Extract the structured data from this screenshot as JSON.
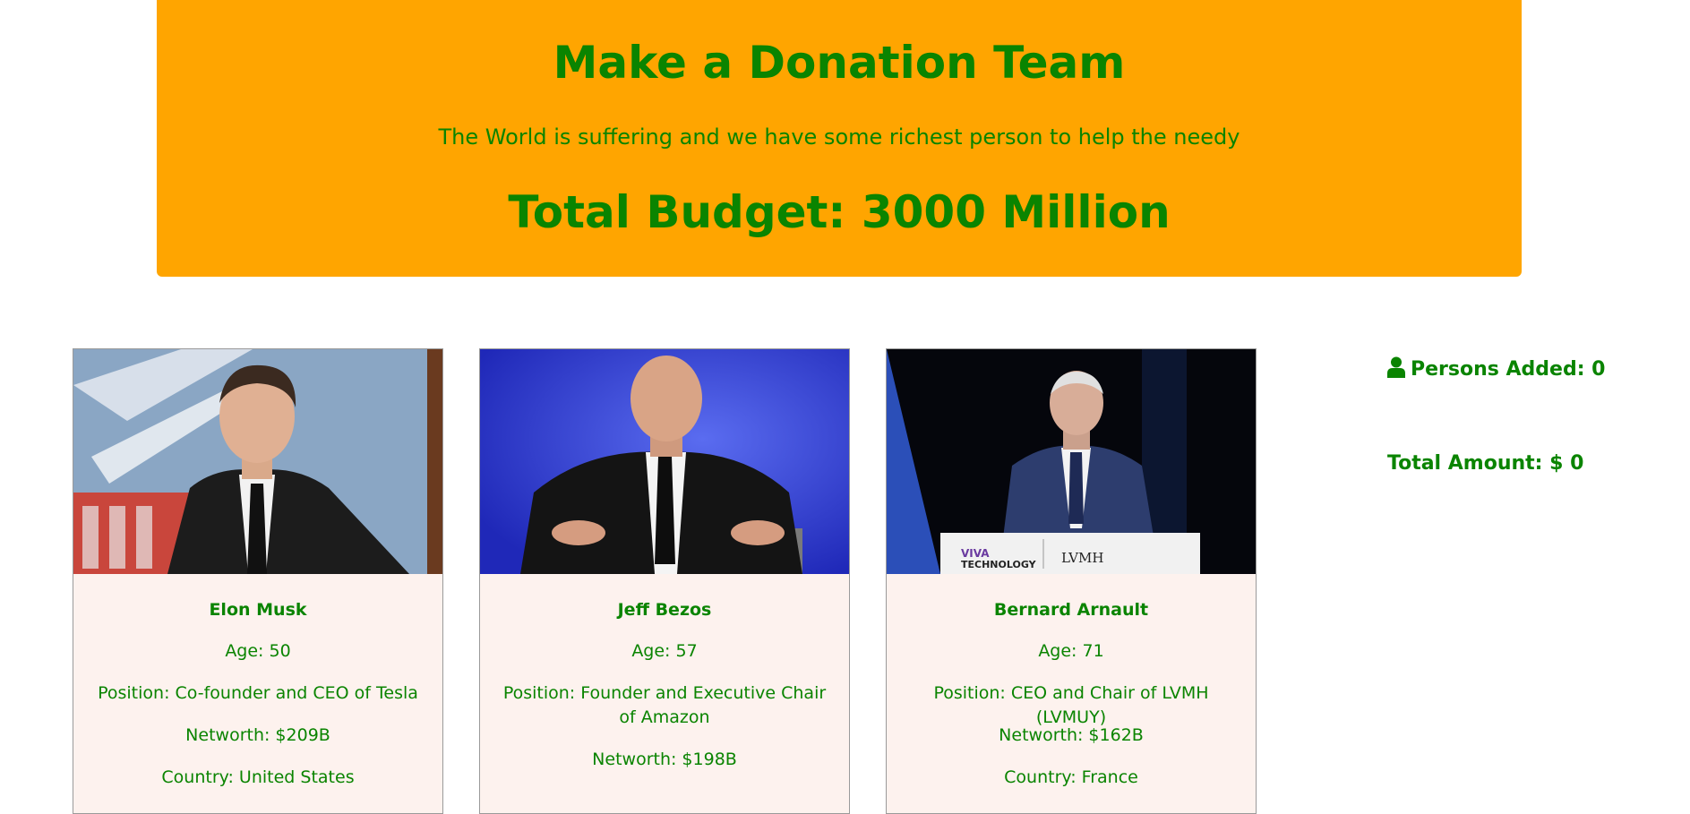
{
  "header": {
    "title": "Make a Donation Team",
    "subtitle": "The World is suffering and we have some richest person to help the needy",
    "budget": "Total Budget: 3000 Million"
  },
  "cards": [
    {
      "name": "Elon Musk",
      "age": "Age: 50",
      "position": "Position: Co-founder and CEO of Tesla",
      "networth": "Networth: $209B",
      "country": "Country: United States"
    },
    {
      "name": "Jeff Bezos",
      "age": "Age: 57",
      "position": "Position: Founder and Executive Chair of Amazon",
      "networth": "Networth: $198B",
      "country": ""
    },
    {
      "name": "Bernard Arnault",
      "age": "Age: 71",
      "position": "Position: CEO and Chair of LVMH (LVMUY)",
      "networth": "Networth: $162B",
      "country": "Country: France",
      "banner_left_top": "VIVA",
      "banner_left_bottom": "TECHNOLOGY",
      "banner_right": "LVMH"
    }
  ],
  "sidebar": {
    "persons_added": "Persons Added: 0",
    "total_amount": "Total Amount: $ 0",
    "icon": "user-icon"
  },
  "colors": {
    "accent": "#0a8400",
    "hero_bg": "#ffa500",
    "card_bg": "#fdf2ee"
  }
}
